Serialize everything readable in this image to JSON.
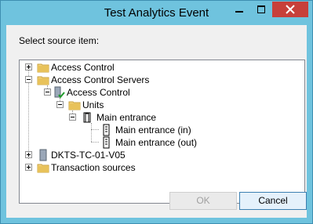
{
  "window": {
    "title": "Test Analytics Event",
    "controls": {
      "minimize": "minimize",
      "maximize": "maximize",
      "close": "close"
    }
  },
  "prompt": "Select source item:",
  "tree": [
    {
      "label": "Access Control",
      "icon": "folder-icon",
      "expander": "plus"
    },
    {
      "label": "Access Control Servers",
      "icon": "folder-icon",
      "expander": "minus"
    },
    {
      "label": "Access Control",
      "icon": "server-check-icon",
      "expander": "minus"
    },
    {
      "label": "Units",
      "icon": "folder-icon",
      "expander": "minus"
    },
    {
      "label": "Main entrance",
      "icon": "door-icon",
      "expander": "minus"
    },
    {
      "label": "Main entrance (in)",
      "icon": "reader-icon",
      "expander": "none"
    },
    {
      "label": "Main entrance (out)",
      "icon": "reader-icon",
      "expander": "none"
    },
    {
      "label": "DKTS-TC-01-V05",
      "icon": "server-icon",
      "expander": "plus"
    },
    {
      "label": "Transaction sources",
      "icon": "folder-icon",
      "expander": "plus"
    }
  ],
  "buttons": {
    "ok": "OK",
    "cancel": "Cancel"
  },
  "colors": {
    "titlebar": "#6fc3de",
    "close": "#c7403a",
    "folder": "#e8c25a"
  }
}
